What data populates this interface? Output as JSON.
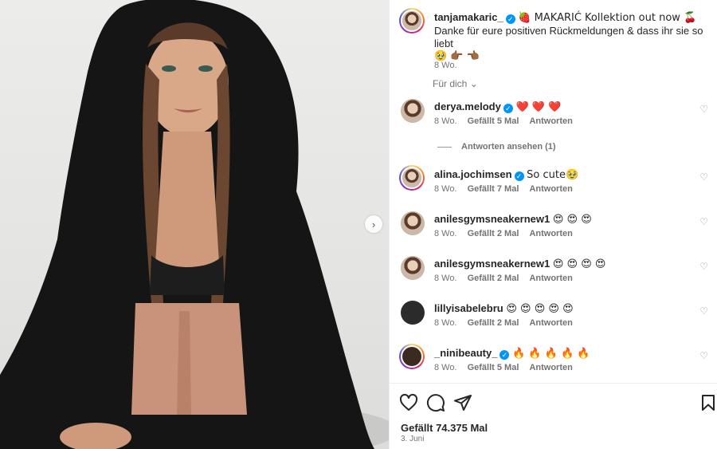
{
  "post": {
    "username": "tanjamakaric_",
    "caption_line1": "🍓 MAKARIĆ Kollektion out now 🍒",
    "caption_line2": "Danke für eure positiven Rückmeldungen & dass ihr sie so liebt",
    "caption_emojis": "🥹 👉🏾 👈🏾",
    "time": "8 Wo."
  },
  "comments_filter": "Für dich",
  "comments": [
    {
      "username": "derya.melody",
      "verified": true,
      "text": "❤️ ❤️ ❤️",
      "time": "8 Wo.",
      "likes": "Gefällt 5 Mal",
      "reply": "Antworten"
    },
    {
      "username": "alina.jochimsen",
      "verified": true,
      "text": "So cute🥹",
      "time": "8 Wo.",
      "likes": "Gefällt 7 Mal",
      "reply": "Antworten"
    },
    {
      "username": "anilesgymsneakernew1",
      "verified": false,
      "text": "😍 😍 😍",
      "time": "8 Wo.",
      "likes": "Gefällt 2 Mal",
      "reply": "Antworten"
    },
    {
      "username": "anilesgymsneakernew1",
      "verified": false,
      "text": "😍 😍 😍 😍",
      "time": "8 Wo.",
      "likes": "Gefällt 2 Mal",
      "reply": "Antworten"
    },
    {
      "username": "lillyisabelebru",
      "verified": false,
      "text": "😍 😍 😍 😍 😍",
      "time": "8 Wo.",
      "likes": "Gefällt 2 Mal",
      "reply": "Antworten"
    },
    {
      "username": "_ninibeauty_",
      "verified": true,
      "text": "🔥 🔥 🔥 🔥 🔥",
      "time": "8 Wo.",
      "likes": "Gefällt 5 Mal",
      "reply": "Antworten"
    }
  ],
  "view_replies": "Antworten ansehen (1)",
  "likes_total": "Gefällt 74.375 Mal",
  "date": "3. Juni",
  "icons": {
    "like": "heart-icon",
    "comment": "comment-icon",
    "share": "share-icon",
    "save": "bookmark-icon",
    "next": "chevron-right-icon"
  },
  "colors": {
    "verified": "#0095f6",
    "secondary_text": "#737373"
  }
}
